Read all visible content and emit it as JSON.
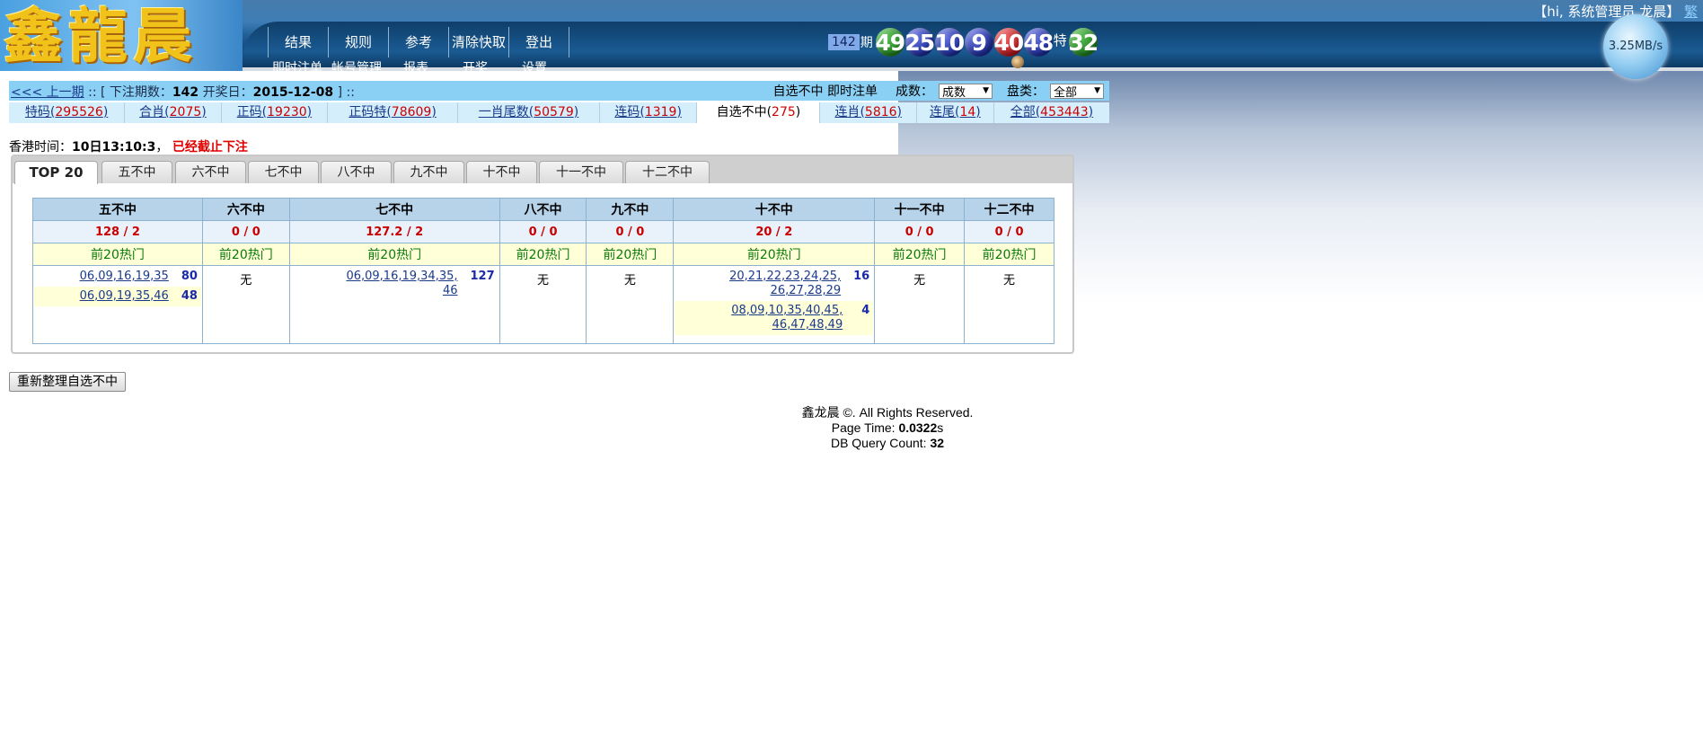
{
  "header": {
    "logo_text": "鑫龍晨",
    "greeting": "【hi, 系统管理员 龙晨】",
    "lang_link": "繁",
    "nav_top": [
      "结果",
      "规则",
      "参考",
      "清除快取",
      "登出"
    ],
    "nav_bottom": [
      "即时注单",
      "帐号管理",
      "报表",
      "开奖",
      "设置"
    ],
    "draw": {
      "period": "142",
      "period_suffix": "期",
      "balls": [
        {
          "num": "49",
          "color": "green"
        },
        {
          "num": "25",
          "color": "blue"
        },
        {
          "num": "10",
          "color": "blue"
        },
        {
          "num": "9",
          "color": "blue"
        },
        {
          "num": "40",
          "color": "red"
        },
        {
          "num": "48",
          "color": "blue"
        }
      ],
      "special_label": "特",
      "special_ball": {
        "num": "32",
        "color": "green"
      }
    },
    "speed": "3.25MB/s"
  },
  "infobar": {
    "prev_link": "<<< 上一期",
    "sep": "::",
    "issue_label": "[ 下注期数：",
    "issue": "142",
    "date_label": "开奖日：",
    "date": "2015-12-08",
    "close": "] ::",
    "right_title": "自选不中 即时注单",
    "count_label": "成数：",
    "count_value": "成数",
    "pan_label": "盘类：",
    "pan_value": "全部"
  },
  "category_tabs": [
    {
      "label": "特码",
      "count": "295526",
      "active": false
    },
    {
      "label": "合肖",
      "count": "2075",
      "active": false
    },
    {
      "label": "正码",
      "count": "19230",
      "active": false
    },
    {
      "label": "正码特",
      "count": "78609",
      "active": false
    },
    {
      "label": "一肖尾数",
      "count": "50579",
      "active": false
    },
    {
      "label": "连码",
      "count": "1319",
      "active": false
    },
    {
      "label": "自选不中",
      "count": "275",
      "active": true
    },
    {
      "label": "连肖",
      "count": "5816",
      "active": false
    },
    {
      "label": "连尾",
      "count": "14",
      "active": false
    },
    {
      "label": "全部",
      "count": "453443",
      "active": false
    }
  ],
  "hk_time": {
    "label": "香港时间",
    "value": "10日13:10:3",
    "status": "已经截止下注"
  },
  "panel_tabs": [
    "TOP 20",
    "五不中",
    "六不中",
    "七不中",
    "八不中",
    "九不中",
    "十不中",
    "十一不中",
    "十二不中"
  ],
  "table": {
    "columns": [
      {
        "header": "五不中",
        "score": "128 / 2",
        "hot": "前20热门",
        "items": [
          {
            "combo": "06,09,16,19,35",
            "count": "80"
          },
          {
            "combo": "06,09,19,35,46",
            "count": "48"
          }
        ]
      },
      {
        "header": "六不中",
        "score": "0 / 0",
        "hot": "前20热门",
        "items": [],
        "empty": "无"
      },
      {
        "header": "七不中",
        "score": "127.2 / 2",
        "hot": "前20热门",
        "items": [
          {
            "combo": "06,09,16,19,34,35, 46",
            "count": "127"
          }
        ]
      },
      {
        "header": "八不中",
        "score": "0 / 0",
        "hot": "前20热门",
        "items": [],
        "empty": "无"
      },
      {
        "header": "九不中",
        "score": "0 / 0",
        "hot": "前20热门",
        "items": [],
        "empty": "无"
      },
      {
        "header": "十不中",
        "score": "20 / 2",
        "hot": "前20热门",
        "items": [
          {
            "combo": "20,21,22,23,24,25, 26,27,28,29",
            "count": "16"
          },
          {
            "combo": "08,09,10,35,40,45, 46,47,48,49",
            "count": "4"
          }
        ]
      },
      {
        "header": "十一不中",
        "score": "0 / 0",
        "hot": "前20热门",
        "items": [],
        "empty": "无"
      },
      {
        "header": "十二不中",
        "score": "0 / 0",
        "hot": "前20热门",
        "items": [],
        "empty": "无"
      }
    ]
  },
  "rebuild_button": "重新整理自选不中",
  "footer": {
    "copyright": "鑫龙晨 ©. All Rights Reserved.",
    "page_time_label": "Page Time: ",
    "page_time": "0.0322",
    "page_time_unit": "s",
    "db_label": "DB Query Count: ",
    "db_count": "32"
  },
  "colors": {
    "infobar_bg": "#8ad0f5",
    "tab_active_bg": "#ffffff",
    "count_red": "#cc0000",
    "status_red": "#e00000",
    "hot_green": "#0a7a0a",
    "table_header_bg": "#b7d3ea",
    "highlight_bg": "#ffffd8"
  }
}
